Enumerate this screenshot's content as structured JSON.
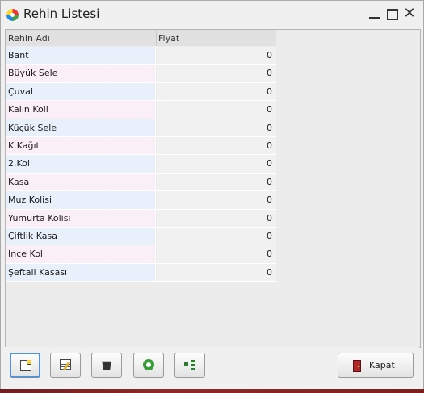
{
  "window": {
    "title": "Rehin Listesi",
    "icons": [
      "app-icon",
      "minimize-icon",
      "maximize-icon",
      "close-icon"
    ]
  },
  "grid": {
    "columns": [
      "Rehin Adı",
      "Fiyat"
    ],
    "rows": [
      {
        "name": "Bant",
        "price": "0"
      },
      {
        "name": "Büyük Sele",
        "price": "0"
      },
      {
        "name": "Çuval",
        "price": "0"
      },
      {
        "name": "Kalın Koli",
        "price": "0"
      },
      {
        "name": "Küçük Sele",
        "price": "0"
      },
      {
        "name": "K.Kağıt",
        "price": "0"
      },
      {
        "name": "2.Koli",
        "price": "0"
      },
      {
        "name": "Kasa",
        "price": "0"
      },
      {
        "name": "Muz Kolisi",
        "price": "0"
      },
      {
        "name": "Yumurta Kolisi",
        "price": "0"
      },
      {
        "name": "Çiftlik Kasa",
        "price": "0"
      },
      {
        "name": "İnce Koli",
        "price": "0"
      },
      {
        "name": "Şeftali Kasası",
        "price": "0"
      }
    ]
  },
  "toolbar": {
    "buttons": [
      "new-icon",
      "edit-icon",
      "delete-icon",
      "refresh-icon",
      "tree-icon"
    ],
    "close_label": "Kapat"
  }
}
